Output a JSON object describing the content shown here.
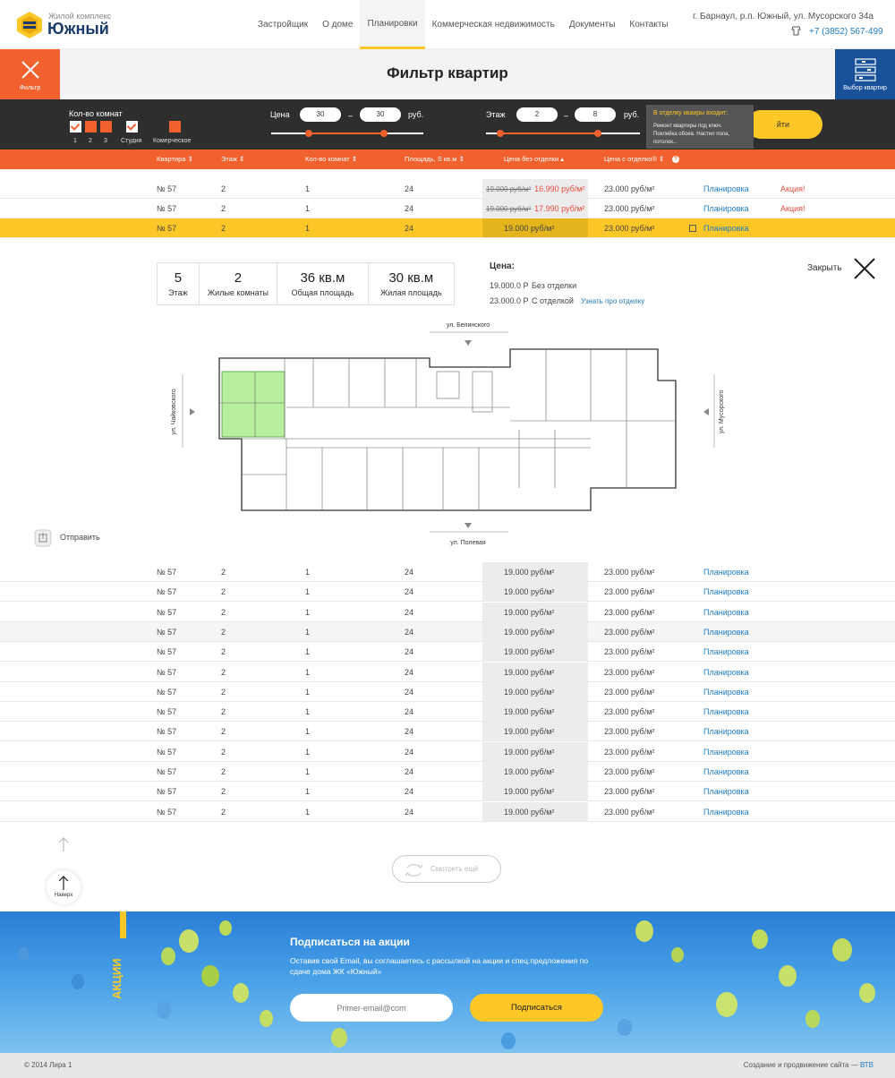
{
  "header": {
    "logo_top": "Жилой комплекс",
    "logo_main": "Южный",
    "nav": [
      "Застройщик",
      "О доме",
      "Планировки",
      "Коммерческая недвижимость",
      "Документы",
      "Контакты"
    ],
    "active_nav": 2,
    "address": "г. Барнаул, р.п. Южный, ул. Мусорского 34а",
    "phone": "+7 (3852) 567-499"
  },
  "title_band": {
    "filter_label": "Фильтр",
    "title": "Фильтр квартир",
    "choose_label": "Выбор квартир"
  },
  "filter": {
    "rooms_label": "Кол-во комнат",
    "room_options": [
      "1",
      "2",
      "3",
      "Студия",
      "Комерческое"
    ],
    "price_label": "Цена",
    "price_from": "30",
    "price_to": "30",
    "price_unit": "руб.",
    "dash": "–",
    "floor_label": "Этаж",
    "floor_from": "2",
    "floor_to": "8",
    "floor_unit": "руб.",
    "find_label": "йти",
    "tooltip_title": "В отделку кваиры входит:",
    "tooltip_body": "Ремонт квартиры под ключ. Поклейка обоев. Настил пола, потолок..."
  },
  "table_header": [
    "Квартира",
    "Этаж",
    "Кол-во комнат",
    "Площадь, S кв.м",
    "Цена без отделки",
    "Цена с отделко"
  ],
  "top_rows": [
    {
      "apt": "№ 57",
      "floor": "2",
      "rooms": "1",
      "area": "24",
      "old": "19.000 руб/м²",
      "price": "16.990 руб/м²",
      "price_fin": "23.000 руб/м²",
      "link": "Планировка",
      "promo": "Акция!"
    },
    {
      "apt": "№ 57",
      "floor": "2",
      "rooms": "1",
      "area": "24",
      "old": "19.000 руб/м²",
      "price": "17.990 руб/м²",
      "price_fin": "23.000 руб/м²",
      "link": "Планировка",
      "promo": "Акция!"
    },
    {
      "apt": "№ 57",
      "floor": "2",
      "rooms": "1",
      "area": "24",
      "old": "",
      "price": "19.000 руб/м²",
      "price_fin": "23.000 руб/м²",
      "link": "Планировка",
      "promo": ""
    }
  ],
  "detail": {
    "stats": [
      {
        "value": "5",
        "label": "Этаж"
      },
      {
        "value": "2",
        "label": "Жилые комнаты"
      },
      {
        "value": "36 кв.м",
        "label": "Общая площадь"
      },
      {
        "value": "30 кв.м",
        "label": "Жилая площадь"
      }
    ],
    "price_title": "Цена:",
    "price_lines": [
      {
        "value": "19.000.0 Р",
        "label": "Без отделки"
      },
      {
        "value": "23.000.0 Р",
        "label": "С отделкой"
      }
    ],
    "finish_link": "Узнать про отделку",
    "close_label": "Закрыть",
    "streets": {
      "top": "ул. Белинского",
      "bottom": "ул. Полевая",
      "left": "ул. Чайковского",
      "right": "ул. Мусорского"
    },
    "send_label": "Отправить"
  },
  "list_rows": {
    "apt": "№ 57",
    "floor": "2",
    "rooms": "1",
    "area": "24",
    "price": "19.000 руб/м²",
    "price_fin": "23.000 руб/м²",
    "link": "Планировка",
    "count": 13
  },
  "more_label": "Смотреть ещё",
  "top_label": "Наверх",
  "subscribe": {
    "side": "АКЦИИ",
    "title": "Подписаться на акции",
    "desc": "Оставив свой Email, вы соглашаетесь с рассылкой на акции и спец.предложения по сдаче дома ЖК «Южный»",
    "placeholder": "Primer-email@com",
    "button": "Подписаться"
  },
  "footer": {
    "copyright": "© 2014 Лира 1",
    "credit": "Создание и продвижение сайта —",
    "credit_link": "ВТВ"
  },
  "colors": {
    "orange": "#f0612d",
    "yellow": "#fdc727",
    "navy": "#19509a",
    "link": "#1e7bc4",
    "dark": "#2e2e2e"
  }
}
